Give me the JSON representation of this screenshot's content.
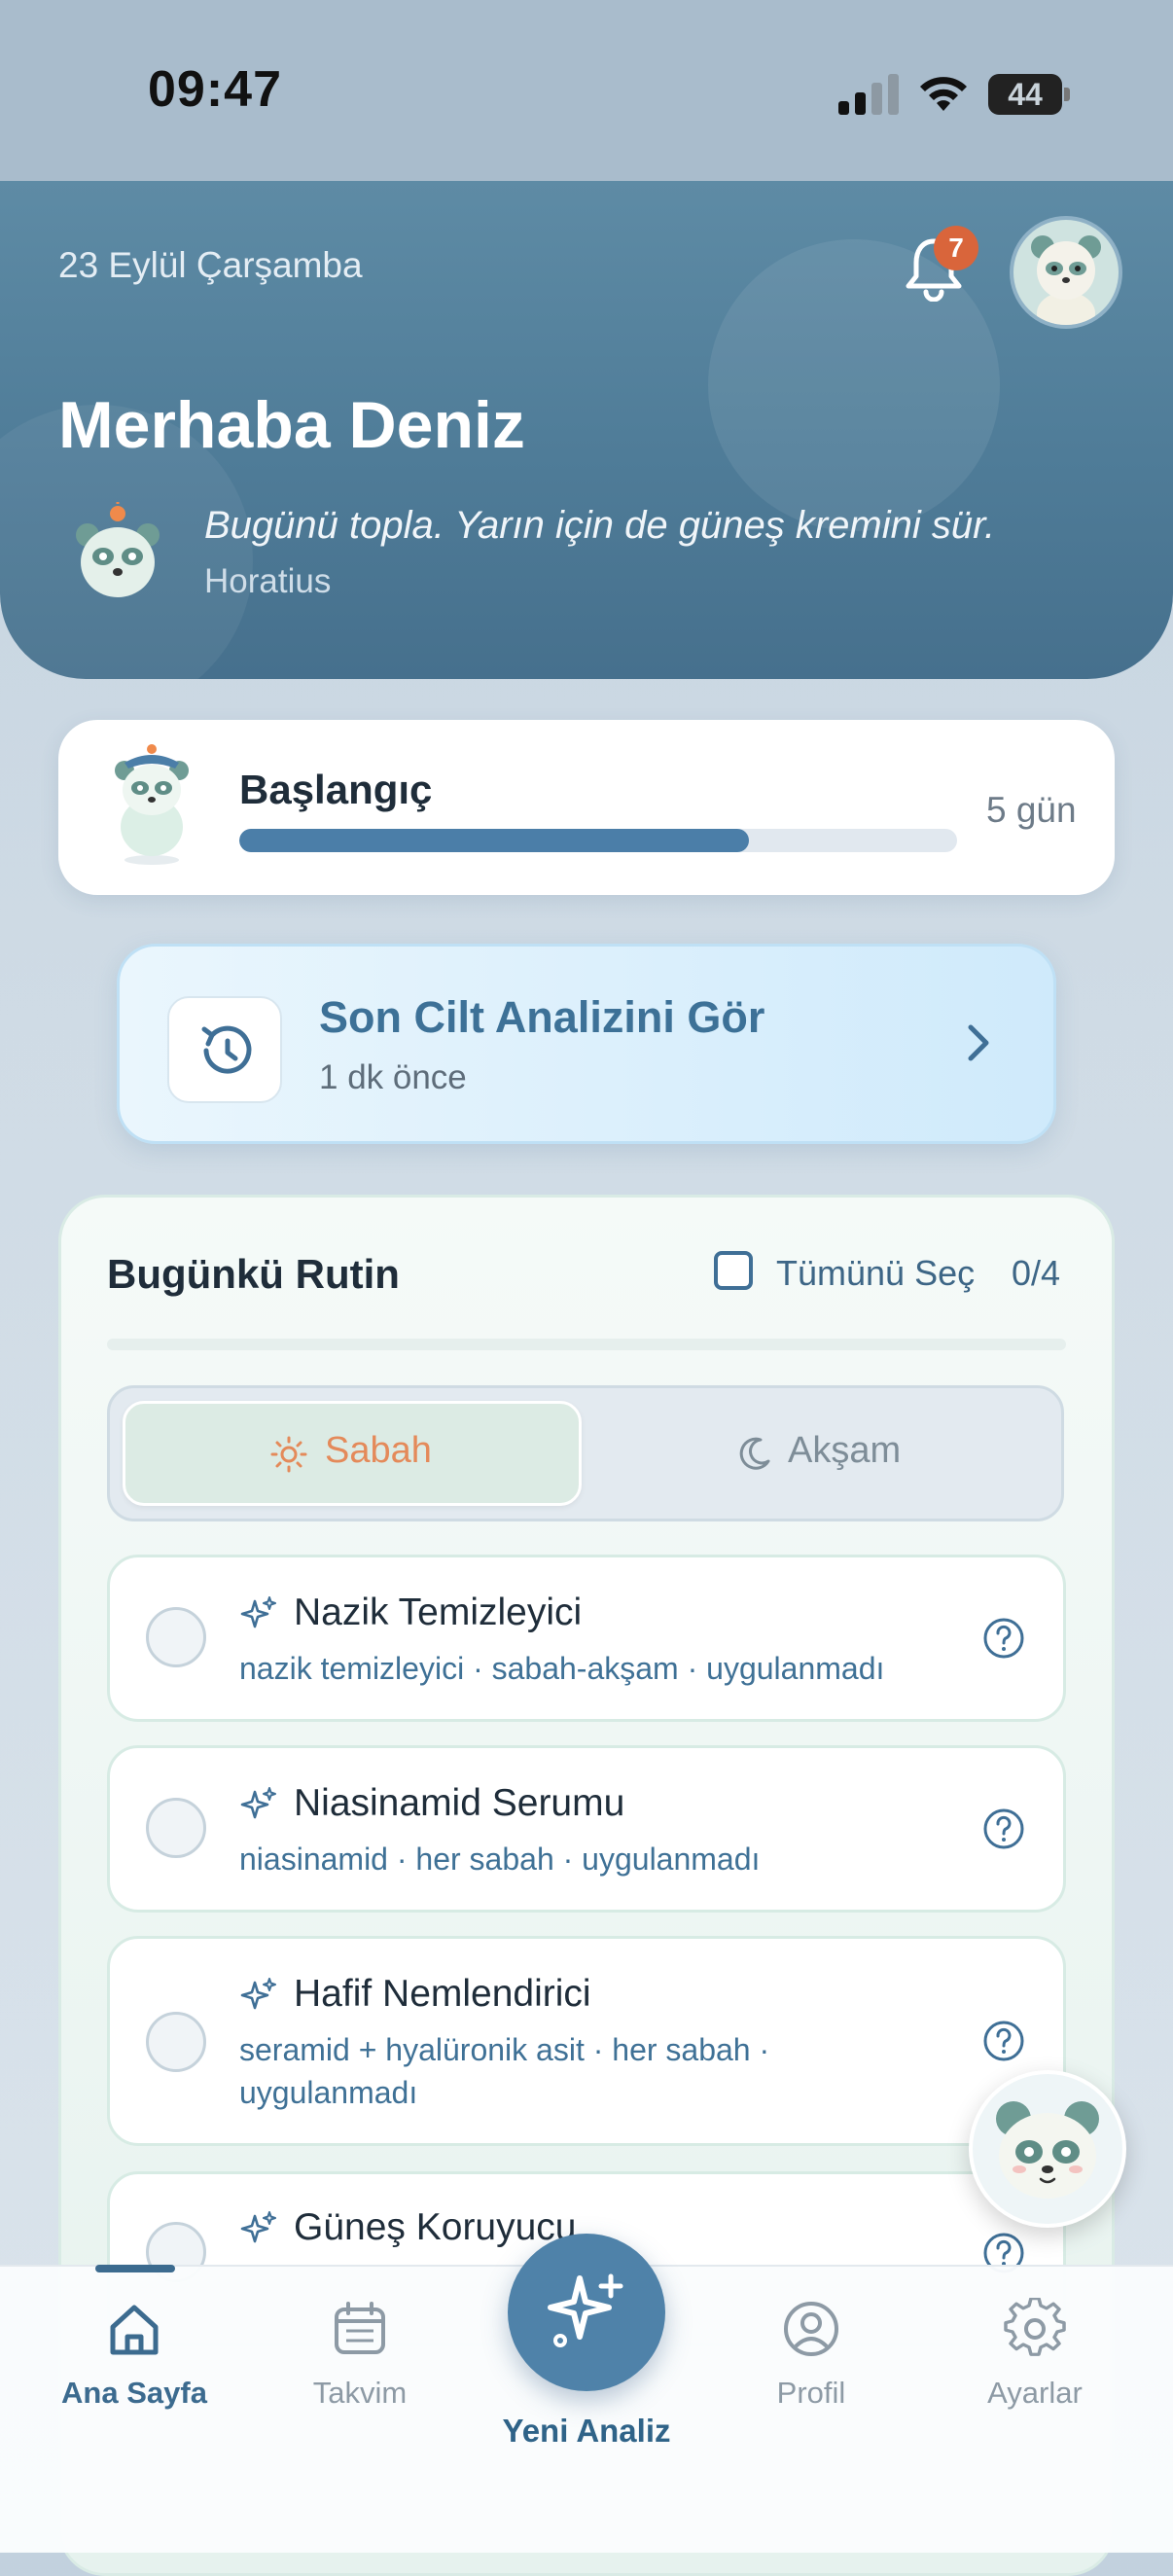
{
  "status_bar": {
    "time": "09:47",
    "battery": "44"
  },
  "header": {
    "date": "23 Eylül Çarşamba",
    "notification_count": "7",
    "greeting": "Merhaba Deniz",
    "quote": "Bugünü topla. Yarın için de güneş kremini sür.",
    "quote_author": "Horatius"
  },
  "level": {
    "title": "Başlangıç",
    "days": "5 gün",
    "progress_fraction": 0.71
  },
  "analysis_card": {
    "title": "Son Cilt Analizini Gör",
    "subtitle": "1 dk önce"
  },
  "routine": {
    "title": "Bugünkü Rutin",
    "select_all_label": "Tümünü Seç",
    "counter": "0/4",
    "segments": {
      "morning": "Sabah",
      "evening": "Akşam",
      "selected": "morning"
    },
    "items": [
      {
        "title": "Nazik Temizleyici",
        "subtitle": "nazik temizleyici · sabah-akşam · uygulanmadı"
      },
      {
        "title": "Niasinamid Serumu",
        "subtitle": "niasinamid · her sabah · uygulanmadı"
      },
      {
        "title": "Hafif Nemlendirici",
        "subtitle_line1": "seramid + hyalüronik asit · her sabah ·",
        "subtitle_line2": "uygulanmadı"
      },
      {
        "title": "Güneş Koruyucu"
      }
    ]
  },
  "tabs": {
    "home": "Ana Sayfa",
    "calendar": "Takvim",
    "new_analysis": "Yeni Analiz",
    "profile": "Profil",
    "settings": "Ayarlar",
    "active": "home"
  },
  "colors": {
    "accent": "#4f82a9",
    "header": "#4f7c98",
    "badge": "#d9653b",
    "morning": "#e48a5a"
  }
}
